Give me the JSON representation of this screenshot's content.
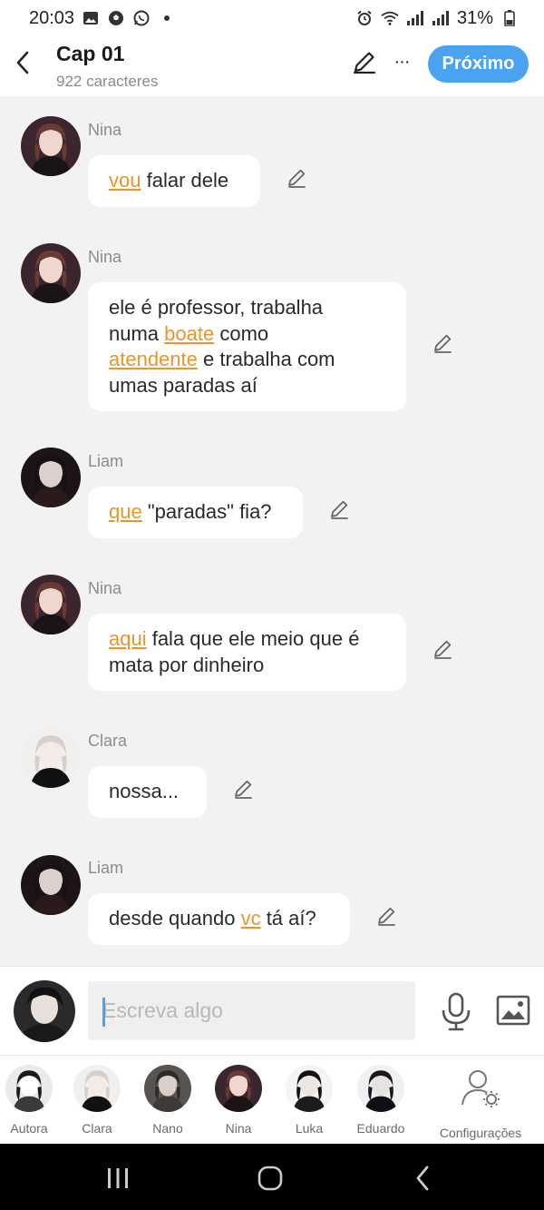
{
  "status_bar": {
    "time": "20:03",
    "battery": "31%"
  },
  "header": {
    "title": "Cap 01",
    "subtitle": "922 caracteres",
    "next_label": "Próximo",
    "more_label": "···"
  },
  "messages": [
    {
      "sender": "Nina",
      "parts": [
        {
          "text": "vou",
          "hl": true
        },
        {
          "text": " falar dele",
          "hl": false
        }
      ]
    },
    {
      "sender": "Nina",
      "parts": [
        {
          "text": "ele é professor, trabalha",
          "hl": false
        },
        {
          "br": true
        },
        {
          "text": "numa ",
          "hl": false
        },
        {
          "text": "boate",
          "hl": true
        },
        {
          "text": " como",
          "hl": false
        },
        {
          "br": true
        },
        {
          "text": "atendente",
          "hl": true
        },
        {
          "text": " e trabalha com",
          "hl": false
        },
        {
          "br": true
        },
        {
          "text": "umas paradas aí",
          "hl": false
        }
      ]
    },
    {
      "sender": "Liam",
      "parts": [
        {
          "text": "que",
          "hl": true
        },
        {
          "text": " \"paradas\" fia?",
          "hl": false
        }
      ]
    },
    {
      "sender": "Nina",
      "parts": [
        {
          "text": "aqui",
          "hl": true
        },
        {
          "text": " fala que ele meio que é",
          "hl": false
        },
        {
          "br": true
        },
        {
          "text": "mata por dinheiro",
          "hl": false
        }
      ]
    },
    {
      "sender": "Clara",
      "parts": [
        {
          "text": "nossa...",
          "hl": false
        }
      ]
    },
    {
      "sender": "Liam",
      "parts": [
        {
          "text": "desde quando ",
          "hl": false
        },
        {
          "text": "vc",
          "hl": true
        },
        {
          "text": " tá aí?",
          "hl": false
        }
      ]
    }
  ],
  "composer": {
    "placeholder": "Escreva algo"
  },
  "characters": [
    {
      "name": "Autora"
    },
    {
      "name": "Clara"
    },
    {
      "name": "Nano"
    },
    {
      "name": "Nina"
    },
    {
      "name": "Luka"
    },
    {
      "name": "Eduardo"
    }
  ],
  "settings_label": "Configurações",
  "colors": {
    "accent": "#4aa3f0",
    "highlight": "#e8962c",
    "background": "#f2f2f2",
    "bubble": "#ffffff"
  }
}
